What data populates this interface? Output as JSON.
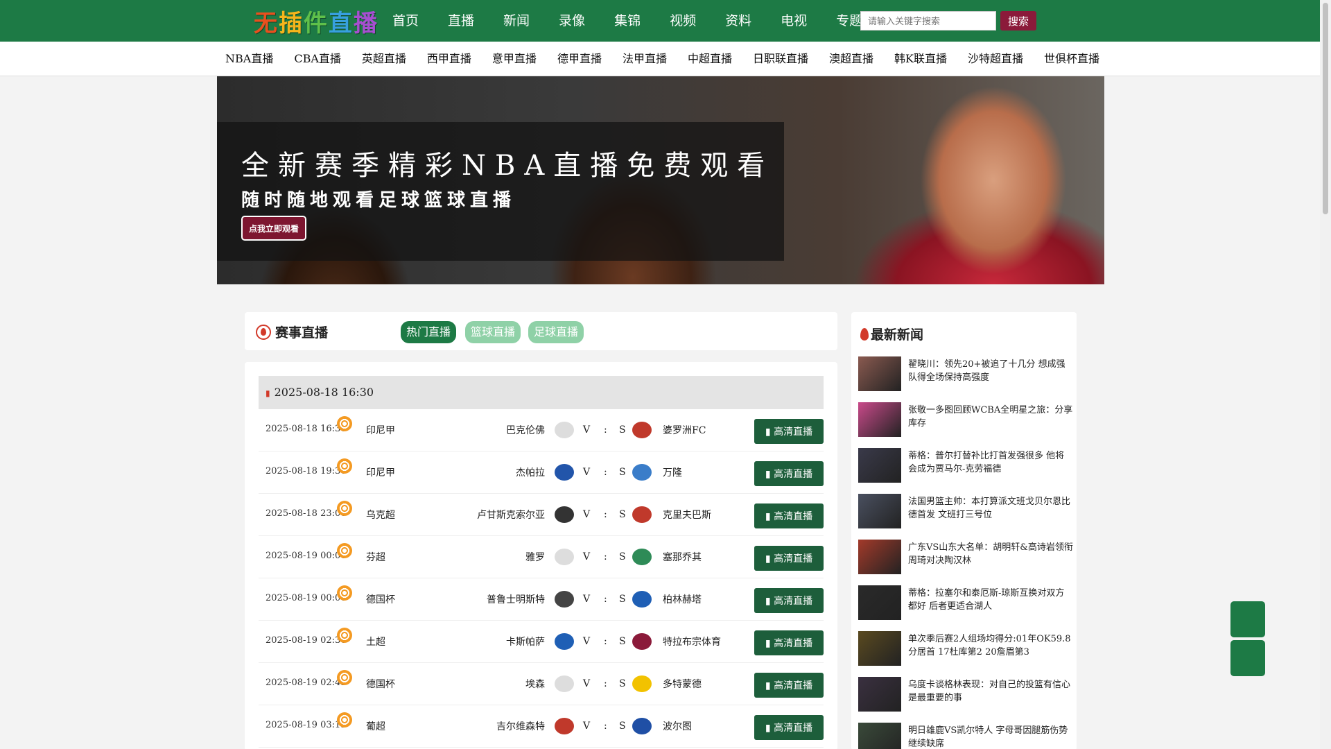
{
  "logo": {
    "text": "无插件直播",
    "colors": [
      "#e8501e",
      "#f5b51c",
      "#5fc04a",
      "#37a0e0",
      "#a74fd0"
    ]
  },
  "main_nav": [
    "首页",
    "直播",
    "新闻",
    "录像",
    "集锦",
    "视频",
    "资料",
    "电视",
    "专题推荐"
  ],
  "search": {
    "placeholder": "请输入关键字搜索",
    "button": "搜索"
  },
  "sub_nav": [
    "NBA直播",
    "CBA直播",
    "英超直播",
    "西甲直播",
    "意甲直播",
    "德甲直播",
    "法甲直播",
    "中超直播",
    "日职联直播",
    "澳超直播",
    "韩K联直播",
    "沙特超直播",
    "世俱杯直播"
  ],
  "banner": {
    "title": "全新赛季精彩NBA直播免费观看",
    "subtitle": "随时随地观看足球篮球直播",
    "button": "点我立即观看"
  },
  "live": {
    "title": "赛事直播",
    "tabs": [
      "热门直播",
      "篮球直播",
      "足球直播"
    ],
    "active_tab": "热门直播",
    "date": "2025-08-18 16:30",
    "matches": [
      {
        "time": "2025-08-18 16:30",
        "league": "印尼甲",
        "home": "巴克伦佛",
        "v": "V",
        "colon": ":",
        "s": "S",
        "away": "婆罗洲FC",
        "button": "高清直播",
        "home_color": "#dddddd",
        "away_color": "#c0392b"
      },
      {
        "time": "2025-08-18 19:30",
        "league": "印尼甲",
        "home": "杰帕拉",
        "v": "V",
        "colon": ":",
        "s": "S",
        "away": "万隆",
        "button": "高清直播",
        "home_color": "#2255aa",
        "away_color": "#3a7dc9"
      },
      {
        "time": "2025-08-18 23:00",
        "league": "乌克超",
        "home": "卢甘斯克索尔亚",
        "v": "V",
        "colon": ":",
        "s": "S",
        "away": "克里夫巴斯",
        "button": "高清直播",
        "home_color": "#333333",
        "away_color": "#c0392b"
      },
      {
        "time": "2025-08-19 00:00",
        "league": "芬超",
        "home": "雅罗",
        "v": "V",
        "colon": ":",
        "s": "S",
        "away": "塞那乔其",
        "button": "高清直播",
        "home_color": "#dddddd",
        "away_color": "#2e8b57"
      },
      {
        "time": "2025-08-19 00:00",
        "league": "德国杯",
        "home": "普鲁士明斯特",
        "v": "V",
        "colon": ":",
        "s": "S",
        "away": "柏林赫塔",
        "button": "高清直播",
        "home_color": "#444444",
        "away_color": "#1f5fb5"
      },
      {
        "time": "2025-08-19 02:30",
        "league": "土超",
        "home": "卡斯帕萨",
        "v": "V",
        "colon": ":",
        "s": "S",
        "away": "特拉布宗体育",
        "button": "高清直播",
        "home_color": "#1f5fb5",
        "away_color": "#8b1a3a"
      },
      {
        "time": "2025-08-19 02:45",
        "league": "德国杯",
        "home": "埃森",
        "v": "V",
        "colon": ":",
        "s": "S",
        "away": "多特蒙德",
        "button": "高清直播",
        "home_color": "#dddddd",
        "away_color": "#f2c200"
      },
      {
        "time": "2025-08-19 03:15",
        "league": "葡超",
        "home": "吉尔维森特",
        "v": "V",
        "colon": ":",
        "s": "S",
        "away": "波尔图",
        "button": "高清直播",
        "home_color": "#c0392b",
        "away_color": "#1f4fa5"
      }
    ]
  },
  "news": {
    "title": "最新新闻",
    "items": [
      {
        "text": "翟晓川：领先20+被追了十几分 想成强队得全场保持高强度",
        "thumb_color": "#8a5a50"
      },
      {
        "text": "张敬一多图回顾WCBA全明星之旅：分享库存",
        "thumb_color": "#c94a8a"
      },
      {
        "text": "蒂格：普尔打替补比打首发强很多 他将会成为贾马尔-克劳福德",
        "thumb_color": "#3a3a4a"
      },
      {
        "text": "法国男篮主帅：本打算派文班戈贝尔恩比德首发 文班打三号位",
        "thumb_color": "#4a5060"
      },
      {
        "text": "广东VS山东大名单：胡明轩&高诗岩领衔 周琦对决陶汉林",
        "thumb_color": "#a33a2a"
      },
      {
        "text": "蒂格：拉塞尔和泰厄斯-琼斯互换对双方都好 后者更适合湖人",
        "thumb_color": "#2a2a2a"
      },
      {
        "text": "单次季后赛2人组场均得分:01年OK59.8分居首 17杜库第2 20詹眉第3",
        "thumb_color": "#5a4a20"
      },
      {
        "text": "乌度卡谈格林表现：对自己的投篮有信心是最重要的事",
        "thumb_color": "#3a3040"
      },
      {
        "text": "明日雄鹿VS凯尔特人 字母哥因腿筋伤势继续缺席",
        "thumb_color": "#3a4a3a"
      }
    ]
  }
}
